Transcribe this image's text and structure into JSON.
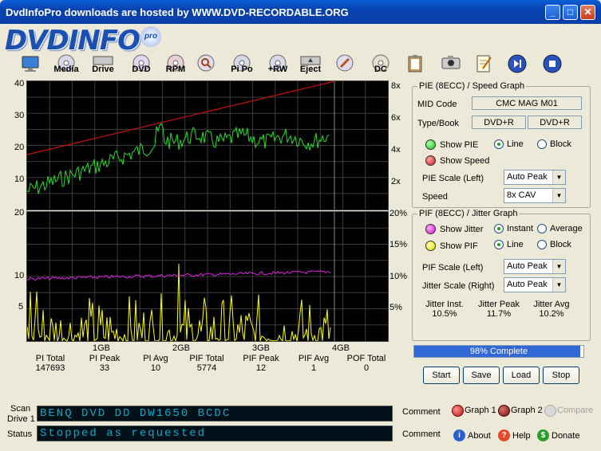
{
  "window": {
    "title": "DvdInfoPro downloads are hosted by WWW.DVD-RECORDABLE.ORG",
    "minimize": "_",
    "maximize": "□",
    "close": "✕"
  },
  "logo": {
    "text": "DVDINFO",
    "badge": "pro"
  },
  "toolbar": [
    {
      "name": "monitor",
      "label": ""
    },
    {
      "name": "media",
      "label": "Media"
    },
    {
      "name": "drive",
      "label": "Drive"
    },
    {
      "name": "dvd",
      "label": "DVD"
    },
    {
      "name": "rpm",
      "label": "RPM"
    },
    {
      "name": "search",
      "label": ""
    },
    {
      "name": "pipo",
      "label": "Pi Po"
    },
    {
      "name": "rw",
      "label": "+RW"
    },
    {
      "name": "eject",
      "label": "Eject"
    },
    {
      "name": "tools",
      "label": ""
    },
    {
      "name": "dc",
      "label": "DC"
    },
    {
      "name": "clipboard",
      "label": ""
    },
    {
      "name": "camera",
      "label": ""
    },
    {
      "name": "notes",
      "label": ""
    },
    {
      "name": "play",
      "label": ""
    },
    {
      "name": "stop",
      "label": ""
    }
  ],
  "graph1": {
    "left_ticks": [
      "40",
      "30",
      "20",
      "10"
    ],
    "right_ticks": [
      "8x",
      "6x",
      "4x",
      "2x"
    ]
  },
  "graph2": {
    "left_ticks": [
      "20",
      "10",
      "5"
    ],
    "right_ticks": [
      "20%",
      "15%",
      "10%",
      "5%"
    ],
    "x_ticks": [
      "1GB",
      "2GB",
      "3GB",
      "4GB"
    ]
  },
  "stats": [
    {
      "label": "PI Total",
      "value": "147693"
    },
    {
      "label": "PI Peak",
      "value": "33"
    },
    {
      "label": "PI Avg",
      "value": "10"
    },
    {
      "label": "PIF Total",
      "value": "5774"
    },
    {
      "label": "PIF Peak",
      "value": "12"
    },
    {
      "label": "PIF Avg",
      "value": "1"
    },
    {
      "label": "POF Total",
      "value": "0"
    }
  ],
  "pie_panel": {
    "title": "PIE (8ECC) / Speed Graph",
    "mid_label": "MID Code",
    "mid_value": "CMC MAG M01",
    "type_label": "Type/Book",
    "type_value": "DVD+R",
    "book_value": "DVD+R",
    "show_pie": "Show PIE",
    "show_speed": "Show Speed",
    "line": "Line",
    "block": "Block",
    "pie_scale_label": "PIE Scale (Left)",
    "pie_scale_value": "Auto Peak",
    "speed_label": "Speed",
    "speed_value": "8x CAV"
  },
  "pif_panel": {
    "title": "PIF (8ECC) / Jitter Graph",
    "show_jitter": "Show Jitter",
    "instant": "Instant",
    "average": "Average",
    "show_pif": "Show PIF",
    "line": "Line",
    "block": "Block",
    "pif_scale_label": "PIF Scale (Left)",
    "pif_scale_value": "Auto Peak",
    "jitter_scale_label": "Jitter Scale (Right)",
    "jitter_scale_value": "Auto Peak",
    "jitter_inst_label": "Jitter Inst.",
    "jitter_inst_value": "10.5%",
    "jitter_peak_label": "Jitter Peak",
    "jitter_peak_value": "11.7%",
    "jitter_avg_label": "Jitter Avg",
    "jitter_avg_value": "10.2%"
  },
  "progress": {
    "text": "98% Complete",
    "fraction": 0.98
  },
  "buttons": {
    "start": "Start",
    "save": "Save",
    "load": "Load",
    "stop": "Stop"
  },
  "bottom": {
    "scan_label": "Scan",
    "drive_label": "Drive 1",
    "status_label": "Status",
    "drive_lcd": "BENQ     DVD DD DW1650 BCDC",
    "status_lcd": "Stopped as requested",
    "comment1": "Comment",
    "comment2": "Comment",
    "graph1": "Graph 1",
    "graph2": "Graph 2",
    "compare": "Compare",
    "about": "About",
    "help": "Help",
    "donate": "Donate"
  },
  "colors": {
    "pie": "#20e020",
    "speed": "#c81010",
    "jitter": "#e020e0",
    "pif": "#ffff00",
    "grid": "#3c3c3c"
  }
}
